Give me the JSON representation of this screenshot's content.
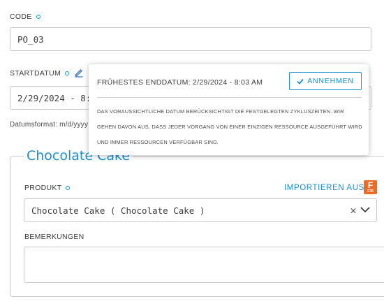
{
  "code": {
    "label": "CODE",
    "value": "PO_03"
  },
  "start_date": {
    "label": "STARTDATUM",
    "value": "2/29/2024 - 8:00",
    "format_hint": "Datumsformat: m/d/yyyy"
  },
  "tooltip": {
    "title": "FRÜHESTES ENDDATUM: 2/29/2024 - 8:03 AM",
    "accept_label": "ANNEHMEN",
    "body": "DAS VORAUSSICHTLICHE DATUM BERÜCKSICHTIGT DIE FESTGELEGTEN ZYKLUSZEITEN. WIR GEHEN DAVON AUS, DASS JEDER VORGANG VON EINER EINZIGEN RESSOURCE AUSGEFÜHRT WIRD UND IMMER RESSOURCEN VERFÜGBAR SIND."
  },
  "product_section": {
    "title": "Chocolate Cake",
    "product_label": "PRODUKT",
    "import_label": "IMPORTIEREN AUS",
    "product_value": "Chocolate Cake ( Chocolate Cake )",
    "remarks_label": "BEMERKUNGEN",
    "remarks_value": ""
  },
  "icons": {
    "required": "required-dot-icon",
    "pencil": "pencil-icon",
    "fusion": "fusion-app-icon",
    "clear": "clear-x-icon",
    "chevron": "chevron-down-icon",
    "check": "check-icon"
  },
  "colors": {
    "accent": "#1a8fd1",
    "fusion_orange": "#f26a21",
    "border": "#c9c9c9",
    "text": "#3c3c3c"
  }
}
